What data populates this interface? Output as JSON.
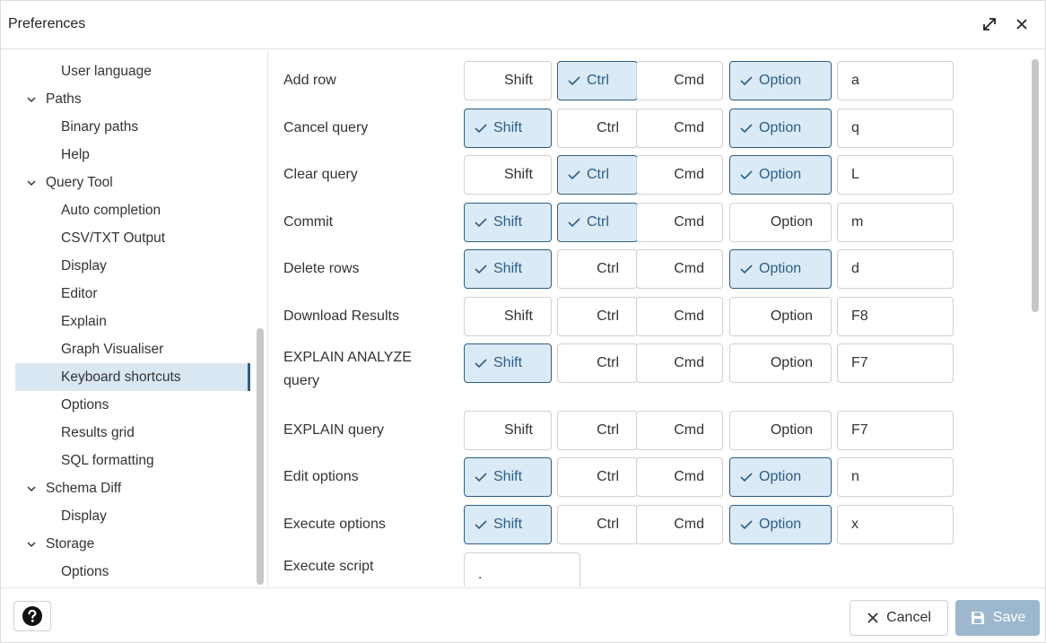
{
  "dialog": {
    "title": "Preferences"
  },
  "tree": {
    "items": [
      {
        "label": "User language",
        "level": "child"
      },
      {
        "label": "Paths",
        "level": "parent"
      },
      {
        "label": "Binary paths",
        "level": "child"
      },
      {
        "label": "Help",
        "level": "child"
      },
      {
        "label": "Query Tool",
        "level": "parent"
      },
      {
        "label": "Auto completion",
        "level": "child"
      },
      {
        "label": "CSV/TXT Output",
        "level": "child"
      },
      {
        "label": "Display",
        "level": "child"
      },
      {
        "label": "Editor",
        "level": "child"
      },
      {
        "label": "Explain",
        "level": "child"
      },
      {
        "label": "Graph Visualiser",
        "level": "child"
      },
      {
        "label": "Keyboard shortcuts",
        "level": "child",
        "selected": true
      },
      {
        "label": "Options",
        "level": "child"
      },
      {
        "label": "Results grid",
        "level": "child"
      },
      {
        "label": "SQL formatting",
        "level": "child"
      },
      {
        "label": "Schema Diff",
        "level": "parent"
      },
      {
        "label": "Display",
        "level": "child"
      },
      {
        "label": "Storage",
        "level": "parent"
      },
      {
        "label": "Options",
        "level": "child"
      }
    ]
  },
  "modifiers": {
    "shift": "Shift",
    "ctrl": "Ctrl",
    "cmd": "Cmd",
    "option": "Option"
  },
  "shortcuts": [
    {
      "name": "Add row",
      "shift": false,
      "ctrl": true,
      "cmd": false,
      "option": true,
      "key": "a"
    },
    {
      "name": "Cancel query",
      "shift": true,
      "ctrl": false,
      "cmd": false,
      "option": true,
      "key": "q"
    },
    {
      "name": "Clear query",
      "shift": false,
      "ctrl": true,
      "cmd": false,
      "option": true,
      "key": "L"
    },
    {
      "name": "Commit",
      "shift": true,
      "ctrl": true,
      "cmd": false,
      "option": false,
      "key": "m"
    },
    {
      "name": "Delete rows",
      "shift": true,
      "ctrl": false,
      "cmd": false,
      "option": true,
      "key": "d"
    },
    {
      "name": "Download Results",
      "shift": false,
      "ctrl": false,
      "cmd": false,
      "option": false,
      "key": "F8"
    },
    {
      "name": "EXPLAIN ANALYZE\nquery",
      "shift": true,
      "ctrl": false,
      "cmd": false,
      "option": false,
      "key": "F7"
    },
    {
      "name": "EXPLAIN query",
      "shift": false,
      "ctrl": false,
      "cmd": false,
      "option": false,
      "key": "F7"
    },
    {
      "name": "Edit options",
      "shift": true,
      "ctrl": false,
      "cmd": false,
      "option": true,
      "key": "n"
    },
    {
      "name": "Execute options",
      "shift": true,
      "ctrl": false,
      "cmd": false,
      "option": true,
      "key": "x"
    }
  ],
  "execute_script": {
    "name": "Execute script",
    "key": "."
  },
  "footer": {
    "cancel_label": "Cancel",
    "save_label": "Save"
  },
  "colors": {
    "accent": "#2c5e87",
    "checked_bg": "#dbeaf7",
    "selected_bg": "#d9e7f3",
    "save_disabled": "#9cb7ce"
  },
  "icons": {
    "expand": "expand-icon",
    "close": "close-icon",
    "chevron": "chevron-down-icon",
    "check": "check-icon",
    "help": "help-icon",
    "cancel": "close-icon",
    "save": "save-icon"
  }
}
